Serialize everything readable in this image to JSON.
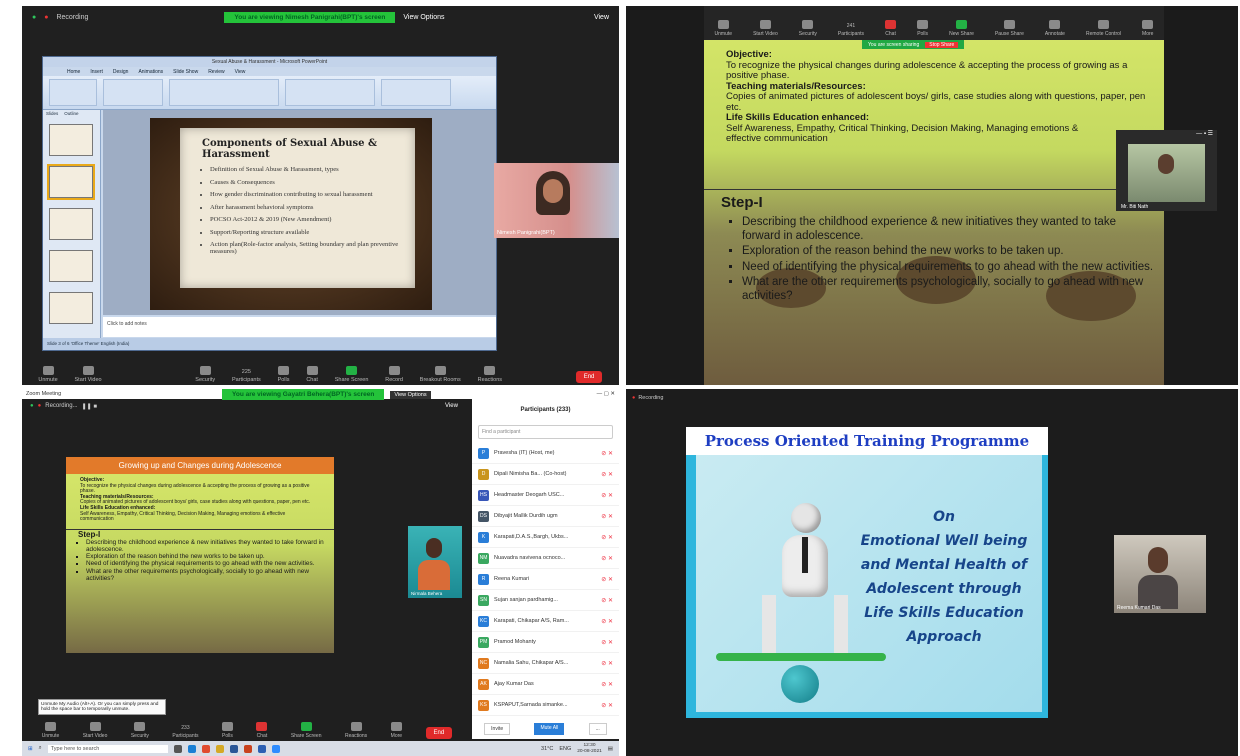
{
  "q1": {
    "recording": "Recording",
    "banner": "You are viewing Nimesh Panigrahi(BPT)'s screen",
    "view_options": "View Options",
    "view": "View",
    "ppt_title": "Sexual Abuse & Harassment - Microsoft PowerPoint",
    "ribbon_tabs": [
      "Home",
      "Insert",
      "Design",
      "Animations",
      "Slide Show",
      "Review",
      "View"
    ],
    "pane_tabs": [
      "Slides",
      "Outline"
    ],
    "slide": {
      "title": "Components of Sexual Abuse & Harassment",
      "bullets": [
        "Definition of Sexual Abuse & Harassment, types",
        "Causes & Consequences",
        "How gender discrimination contributing to sexual harassment",
        "After harassment behavioral symptoms",
        "POCSO Act-2012 & 2019 (New Amendment)",
        "Support/Reporting structure available",
        "Action plan(Role-factor analysis, Setting boundary and plan preventive measures)"
      ]
    },
    "notes": "Click to add notes",
    "status": "Slide 3 of 6    'Office Theme'    English (India)",
    "participant": "Nimesh Panigrahi(BPT)",
    "toolbar": [
      "Unmute",
      "Start Video",
      "Security",
      "Participants",
      "Polls",
      "Chat",
      "Share Screen",
      "Record",
      "Breakout Rooms",
      "Reactions"
    ],
    "participants_count": "225",
    "end": "End"
  },
  "q2": {
    "toolbar": [
      "Unmute",
      "Start Video",
      "Security",
      "Participants",
      "Chat",
      "Polls",
      "New Share",
      "Pause Share",
      "Annotate",
      "Remote Control",
      "More"
    ],
    "participants_count": "241",
    "sharing": "You are screen sharing",
    "stop_share": "Stop Share",
    "objective_h": "Objective:",
    "objective": "To recognize the physical changes during adolescence & accepting the process of growing as a positive phase.",
    "materials_h": "Teaching materials/Resources:",
    "materials": "Copies of animated pictures of adolescent boys/ girls, case studies along with questions, paper, pen etc.",
    "lse_h": "Life Skills Education enhanced:",
    "lse": "Self Awareness, Empathy, Critical Thinking, Decision Making, Managing emotions & effective communication",
    "step": "Step-I",
    "bullets": [
      "Describing the childhood experience & new initiatives they wanted to take forward in adolescence.",
      "Exploration of the reason behind the new works to be taken up.",
      "Need of identifying the physical requirements to go ahead with the new activities.",
      "What are the other requirements psychologically, socially to go ahead with new activities?"
    ],
    "participant": "Mr. Biti Nath"
  },
  "q3": {
    "window_title": "Zoom Meeting",
    "recording": "Recording...",
    "banner": "You are viewing Gayatri Behera(BPT)'s screen",
    "view_options": "View Options",
    "view": "View",
    "slide_title": "Growing up and Changes during Adolescence",
    "participant": "Nirmala Behera",
    "mute_tip": "Unmute My Audio (Alt+A). Or you can simply press and hold the space bar to temporarily unmute.",
    "participants_title": "Participants (233)",
    "find": "Find a participant",
    "people": [
      {
        "initials": "P",
        "name": "Pravesha (IT) (Host, me)",
        "color": "#2a7ed8"
      },
      {
        "initials": "D",
        "name": "Dipali Nimisha Ba... (Co-host)",
        "color": "#c9951d"
      },
      {
        "initials": "HS",
        "name": "Headmaster Deogarh USC...",
        "color": "#3856b8"
      },
      {
        "initials": "DS",
        "name": "Dibyajit Mallik Durdih ugm",
        "color": "#445566"
      },
      {
        "initials": "K",
        "name": "Karapati,D.A.S.,Bargh, Ukbs...",
        "color": "#2a7ed8"
      },
      {
        "initials": "NM",
        "name": "Nuavadra navivena ocnoco...",
        "color": "#3aa860"
      },
      {
        "initials": "R",
        "name": "Reena Kumari",
        "color": "#2a7ed8"
      },
      {
        "initials": "SN",
        "name": "Sujan sanjan pardhamig...",
        "color": "#3aa860"
      },
      {
        "initials": "KC",
        "name": "Karapati, Chikapar A/S, Ram...",
        "color": "#2a7ed8"
      },
      {
        "initials": "PM",
        "name": "Pramod Mohanty",
        "color": "#3aa860"
      },
      {
        "initials": "NC",
        "name": "Namalia Sahu, Chikapar A/S...",
        "color": "#e07a1f"
      },
      {
        "initials": "AK",
        "name": "Ajay Kumar Das",
        "color": "#e07a1f"
      },
      {
        "initials": "KS",
        "name": "KSPAPUT,Sarnada simanke...",
        "color": "#e07a1f"
      }
    ],
    "invite": "Invite",
    "mute_all": "Mute All",
    "more": "...",
    "toolbar": [
      "Unmute",
      "Start Video",
      "Security",
      "Participants",
      "Polls",
      "Chat",
      "Share Screen",
      "Reactions",
      "More"
    ],
    "participants_count": "233",
    "end": "End",
    "search_placeholder": "Type here to search",
    "temp": "31°C",
    "lang": "ENG",
    "time": "12:30",
    "date": "20-08-2021"
  },
  "q4": {
    "recording": "Recording",
    "slide_title": "Process Oriented Training Programme",
    "body": [
      "On",
      "Emotional Well being",
      "and Mental Health of",
      "Adolescent through",
      "Life Skills Education",
      "Approach"
    ],
    "participant": "Reema Kumari Das"
  }
}
